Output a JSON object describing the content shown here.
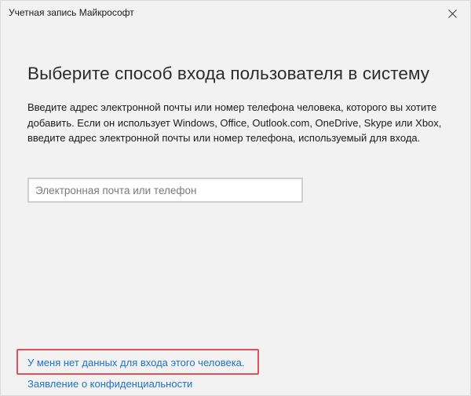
{
  "window": {
    "title": "Учетная запись Майкрософт",
    "close_icon": "close-icon"
  },
  "main": {
    "heading": "Выберите способ входа пользователя в систему",
    "description": "Введите адрес электронной почты или номер телефона человека, которого вы хотите добавить. Если он использует Windows, Office, Outlook.com, OneDrive, Skype или Xbox, введите адрес электронной почты или номер телефона, используемый для входа.",
    "email_input": {
      "value": "",
      "placeholder": "Электронная почта или телефон"
    }
  },
  "footer": {
    "no_data_link": "У меня нет данных для входа этого человека.",
    "privacy_link": "Заявление о конфиденциальности"
  },
  "colors": {
    "background": "#f2f2f2",
    "link": "#1f72c7",
    "highlight": "#e0515b",
    "input_border": "#cfcfcf"
  }
}
